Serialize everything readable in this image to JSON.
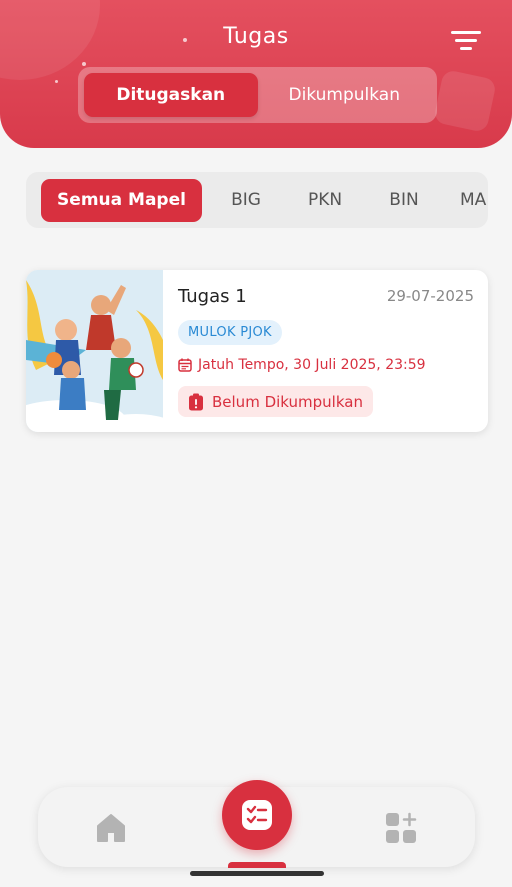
{
  "header": {
    "title": "Tugas",
    "filter_icon": "filter-icon",
    "tabs": [
      {
        "label": "Ditugaskan",
        "active": true
      },
      {
        "label": "Dikumpulkan",
        "active": false
      }
    ]
  },
  "subjects": {
    "items": [
      {
        "label": "Semua Mapel",
        "active": true
      },
      {
        "label": "BIG",
        "active": false
      },
      {
        "label": "PKN",
        "active": false
      },
      {
        "label": "BIN",
        "active": false
      },
      {
        "label": "MA",
        "active": false
      }
    ]
  },
  "assignments": [
    {
      "title": "Tugas 1",
      "date": "29-07-2025",
      "subject_tag": "MULOK PJOK",
      "due": "Jatuh Tempo, 30 Juli 2025, 23:59",
      "due_icon": "calendar-icon",
      "status": "Belum Dikumpulkan",
      "status_icon": "alert-clipboard-icon"
    }
  ],
  "bottom_nav": {
    "items": [
      {
        "icon": "home-icon"
      },
      {
        "icon": "task-list-icon",
        "active": true
      },
      {
        "icon": "apps-add-icon"
      }
    ]
  },
  "colors": {
    "primary": "#d8303f",
    "header": "#e04556",
    "tag_bg": "#e3f1fc",
    "tag_text": "#2a8ad4",
    "status_bg": "#fde8e8"
  }
}
